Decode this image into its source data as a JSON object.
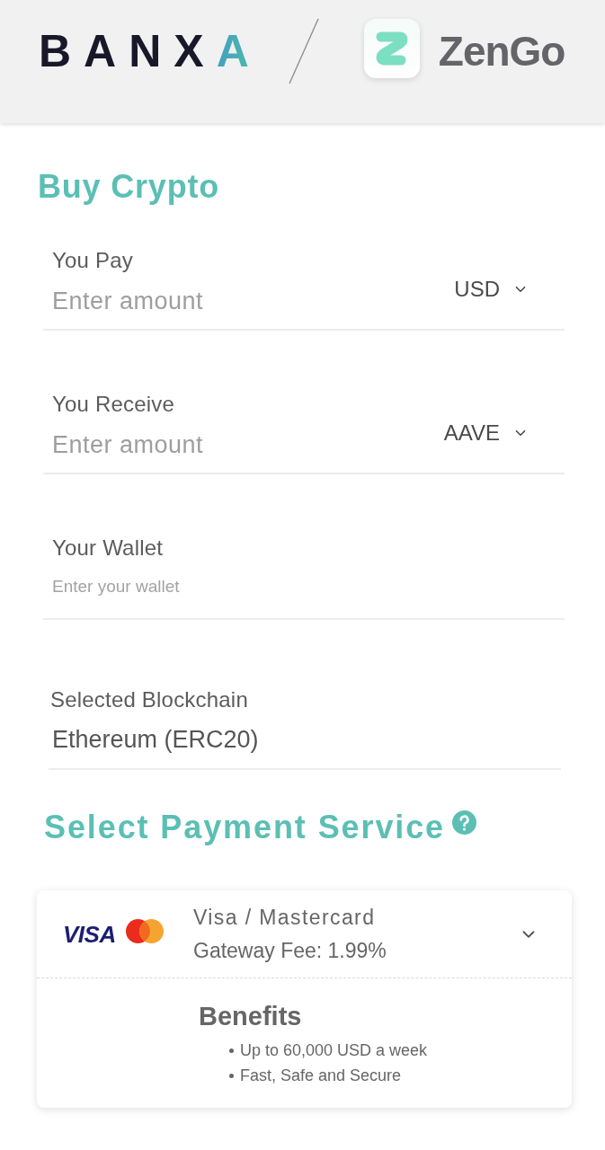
{
  "header": {
    "brand_logo": "BANXA",
    "partner_logo": "ZenGo"
  },
  "title": "Buy Crypto",
  "fields": [
    {
      "kind": "amount",
      "label": "You Pay",
      "placeholder": "Enter amount",
      "currency": "USD"
    },
    {
      "kind": "amount",
      "label": "You Receive",
      "placeholder": "Enter amount",
      "currency": "AAVE"
    },
    {
      "kind": "wallet",
      "label": "Your Wallet",
      "placeholder": "Enter your wallet"
    },
    {
      "kind": "readonly",
      "label": "Selected Blockchain",
      "value": "Ethereum (ERC20)"
    }
  ],
  "payment": {
    "title": "Select Payment Service",
    "services": [
      {
        "logo_text": "VISA",
        "name": "Visa / Mastercard",
        "fee": "Gateway Fee: 1.99%",
        "expanded": true,
        "benefits_title": "Benefits",
        "benefits": [
          "Up to 60,000 USD a week",
          "Fast, Safe and Secure"
        ]
      }
    ]
  }
}
